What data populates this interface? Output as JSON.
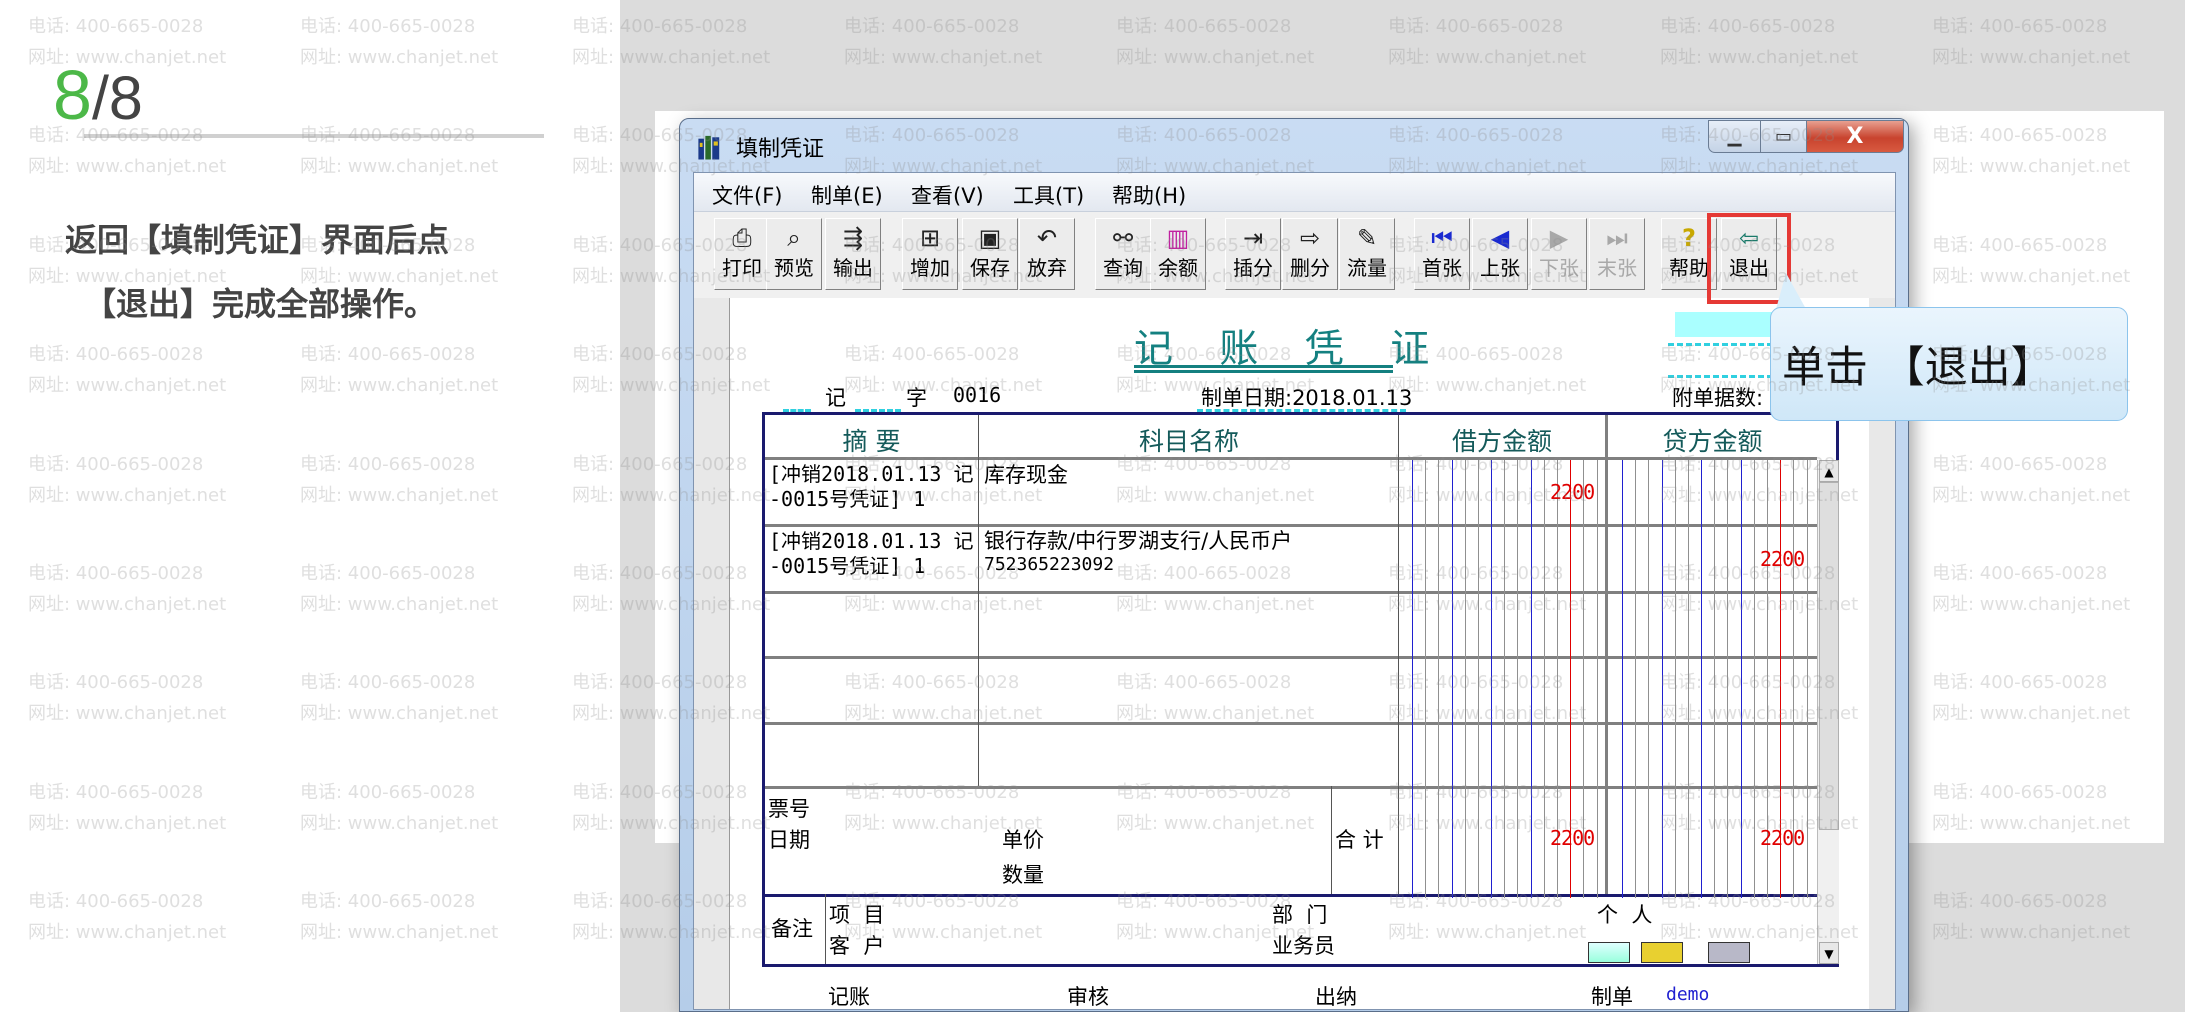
{
  "tutorial": {
    "step_current": "8",
    "step_total": "/8",
    "line1": "返回【填制凭证】界面后点",
    "line2": "【退出】完成全部操作。"
  },
  "watermark": {
    "phone": "电话: 400-665-0028",
    "site": "网址: www.chanjet.net"
  },
  "window": {
    "title": "填制凭证",
    "minimize": "▁",
    "maximize": "▭",
    "close": "X"
  },
  "menu": [
    "文件(F)",
    "制单(E)",
    "查看(V)",
    "工具(T)",
    "帮助(H)"
  ],
  "toolbar": [
    {
      "label": "打印",
      "icon": "printer-icon",
      "glyph": "⎙",
      "disabled": false
    },
    {
      "label": "预览",
      "icon": "preview-icon",
      "glyph": "⌕",
      "disabled": false
    },
    {
      "label": "输出",
      "icon": "export-icon",
      "glyph": "⇶",
      "disabled": false
    },
    {
      "label": "增加",
      "icon": "add-icon",
      "glyph": "⊞",
      "disabled": false
    },
    {
      "label": "保存",
      "icon": "save-icon",
      "glyph": "▣",
      "disabled": false
    },
    {
      "label": "放弃",
      "icon": "undo-icon",
      "glyph": "↶",
      "disabled": false
    },
    {
      "label": "查询",
      "icon": "binoculars-icon",
      "glyph": "⚯",
      "disabled": false
    },
    {
      "label": "余额",
      "icon": "bar-chart-icon",
      "glyph": "▥",
      "disabled": false
    },
    {
      "label": "插分",
      "icon": "insert-row-icon",
      "glyph": "⇥",
      "disabled": false
    },
    {
      "label": "删分",
      "icon": "delete-row-icon",
      "glyph": "⇨",
      "disabled": false
    },
    {
      "label": "流量",
      "icon": "edit-icon",
      "glyph": "✎",
      "disabled": false
    },
    {
      "label": "首张",
      "icon": "first-icon",
      "glyph": "⏮",
      "disabled": false
    },
    {
      "label": "上张",
      "icon": "previous-icon",
      "glyph": "◀",
      "disabled": false
    },
    {
      "label": "下张",
      "icon": "next-icon",
      "glyph": "▶",
      "disabled": true
    },
    {
      "label": "末张",
      "icon": "last-icon",
      "glyph": "⏭",
      "disabled": true
    },
    {
      "label": "帮助",
      "icon": "help-icon",
      "glyph": "?",
      "disabled": false
    },
    {
      "label": "退出",
      "icon": "exit-door-icon",
      "glyph": "⇦",
      "disabled": false
    }
  ],
  "voucher": {
    "title": "记 账 凭 证",
    "type": "记",
    "zi": "字",
    "number": "0016",
    "date_label": "制单日期:2018.01.13",
    "attachments_label": "附单据数:",
    "headers": [
      "摘 要",
      "科目名称",
      "借方金额",
      "贷方金额"
    ],
    "rows": [
      {
        "summary": [
          "[冲销2018.01.13 记",
          "-0015号凭证] 1"
        ],
        "account": "库存现金",
        "account_sub": "",
        "debit": "2200",
        "credit": ""
      },
      {
        "summary": [
          "[冲销2018.01.13 记",
          "-0015号凭证] 1"
        ],
        "account": "银行存款/中行罗湖支行/人民币户",
        "account_sub": "752365223092",
        "debit": "",
        "credit": "2200"
      }
    ],
    "ticket_no": "票号",
    "date": "日期",
    "unit_price": "单价",
    "quantity": "数量",
    "total_label": "合 计",
    "total_debit": "2200",
    "total_credit": "2200",
    "remark": "备注",
    "project": "项  目",
    "customer": "客  户",
    "dept": "部  门",
    "salesman": "业务员",
    "person": "个  人",
    "sign": {
      "bookkeeping": "记账",
      "review": "审核",
      "cashier": "出纳",
      "maker": "制单",
      "maker_name": "demo"
    }
  },
  "callout": {
    "text": "单击 【退出】"
  },
  "colors": {
    "accent_green": "#4cb848",
    "teal": "#148080",
    "amount_red": "#e00000",
    "highlight_red": "#e53935"
  }
}
